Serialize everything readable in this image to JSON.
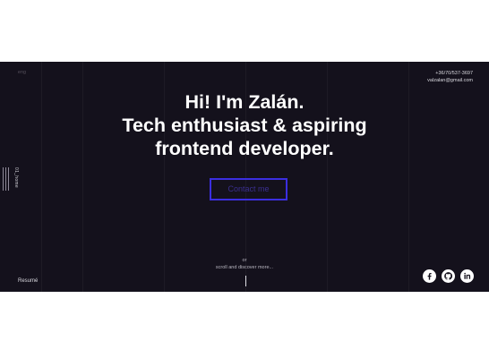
{
  "header": {
    "language": "eng",
    "phone": "+36/70/537-3697",
    "email": "valzalan@gmail.com"
  },
  "sidebar": {
    "label": "01_home"
  },
  "hero": {
    "line1": "Hi! I'm Zalán.",
    "line2": "Tech enthusiast & aspiring",
    "line3": "frontend developer.",
    "contact_button": "Contact me"
  },
  "footer": {
    "resume_link": "Resumé",
    "scroll_or": "or",
    "scroll_text": "scroll and discover more...",
    "social_icons": [
      "facebook-icon",
      "github-icon",
      "linkedin-icon"
    ]
  },
  "colors": {
    "background": "#14111c",
    "accent": "#3b2ee0",
    "text": "#ffffff"
  }
}
